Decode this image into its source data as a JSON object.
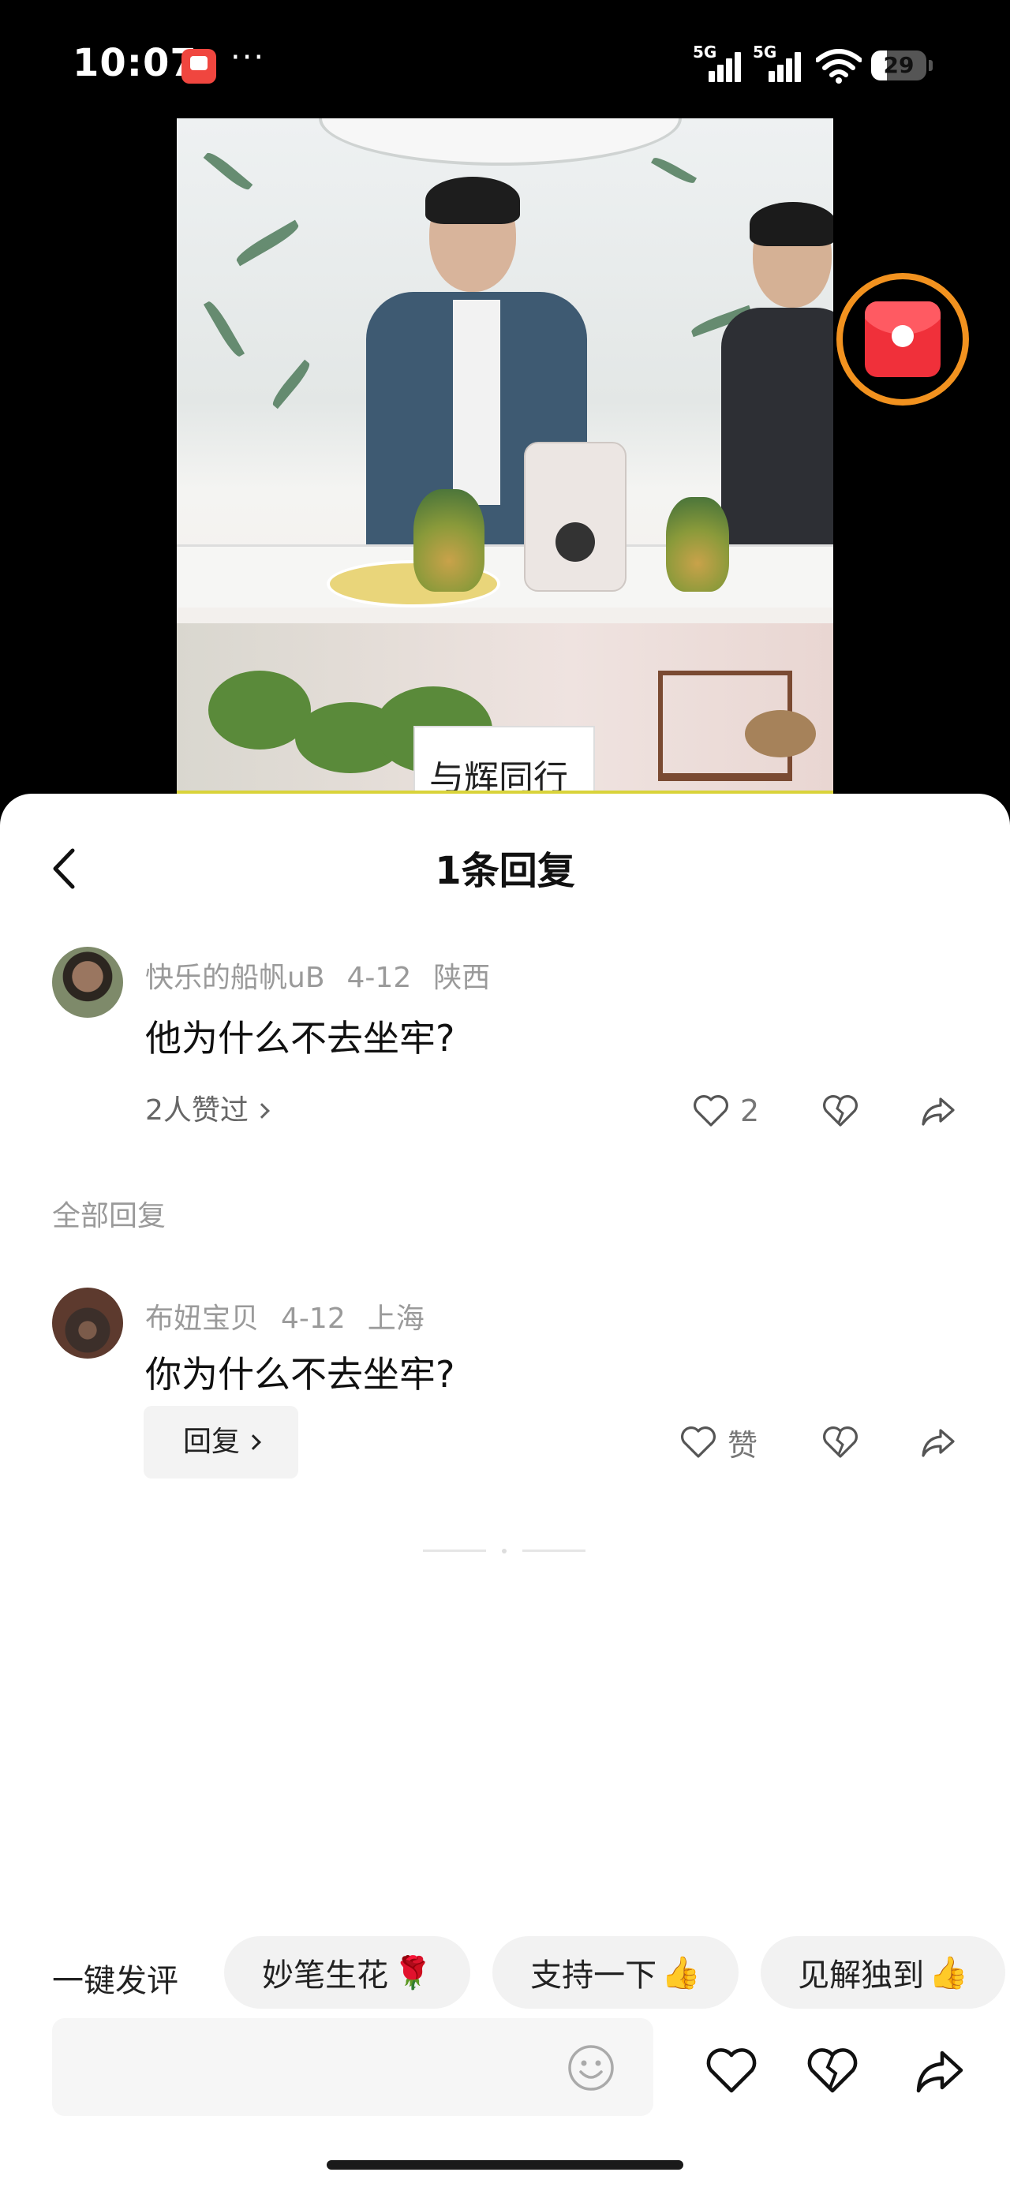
{
  "status_bar": {
    "time": "10:07",
    "dots": "···",
    "signal1_tag": "5G",
    "signal2_tag": "5G",
    "battery_level": "29",
    "battery_fraction": 0.29
  },
  "video": {
    "sign_text": "与辉同行"
  },
  "header": {
    "title": "1条回复"
  },
  "main_comment": {
    "username": "快乐的船帆uB",
    "date": "4-12",
    "location": "陕西",
    "text": "他为什么不去坐牢?",
    "likers_text": "2人赞过",
    "like_count": "2"
  },
  "replies_section": {
    "label": "全部回复"
  },
  "reply": {
    "username": "布妞宝贝",
    "date": "4-12",
    "location": "上海",
    "text": "你为什么不去坐牢?",
    "reply_button_label": "回复",
    "like_label": "赞"
  },
  "quick_reply": {
    "label": "一键发评",
    "chips": [
      {
        "text": "妙笔生花",
        "emoji": "🌹"
      },
      {
        "text": "支持一下",
        "emoji": "👍"
      },
      {
        "text": "见解独到",
        "emoji": "👍"
      }
    ]
  },
  "composer": {
    "placeholder": ""
  },
  "colors": {
    "accent_orange": "#f2921f",
    "red_envelope": "#f0303a",
    "chip_bg": "#f2f2f2",
    "meta_gray": "#9a9a9a"
  },
  "icons": [
    "back-icon",
    "heart-icon",
    "broken-heart-icon",
    "share-icon",
    "emoji-icon",
    "red-envelope-icon",
    "wifi-icon",
    "signal-icon",
    "battery-icon"
  ]
}
